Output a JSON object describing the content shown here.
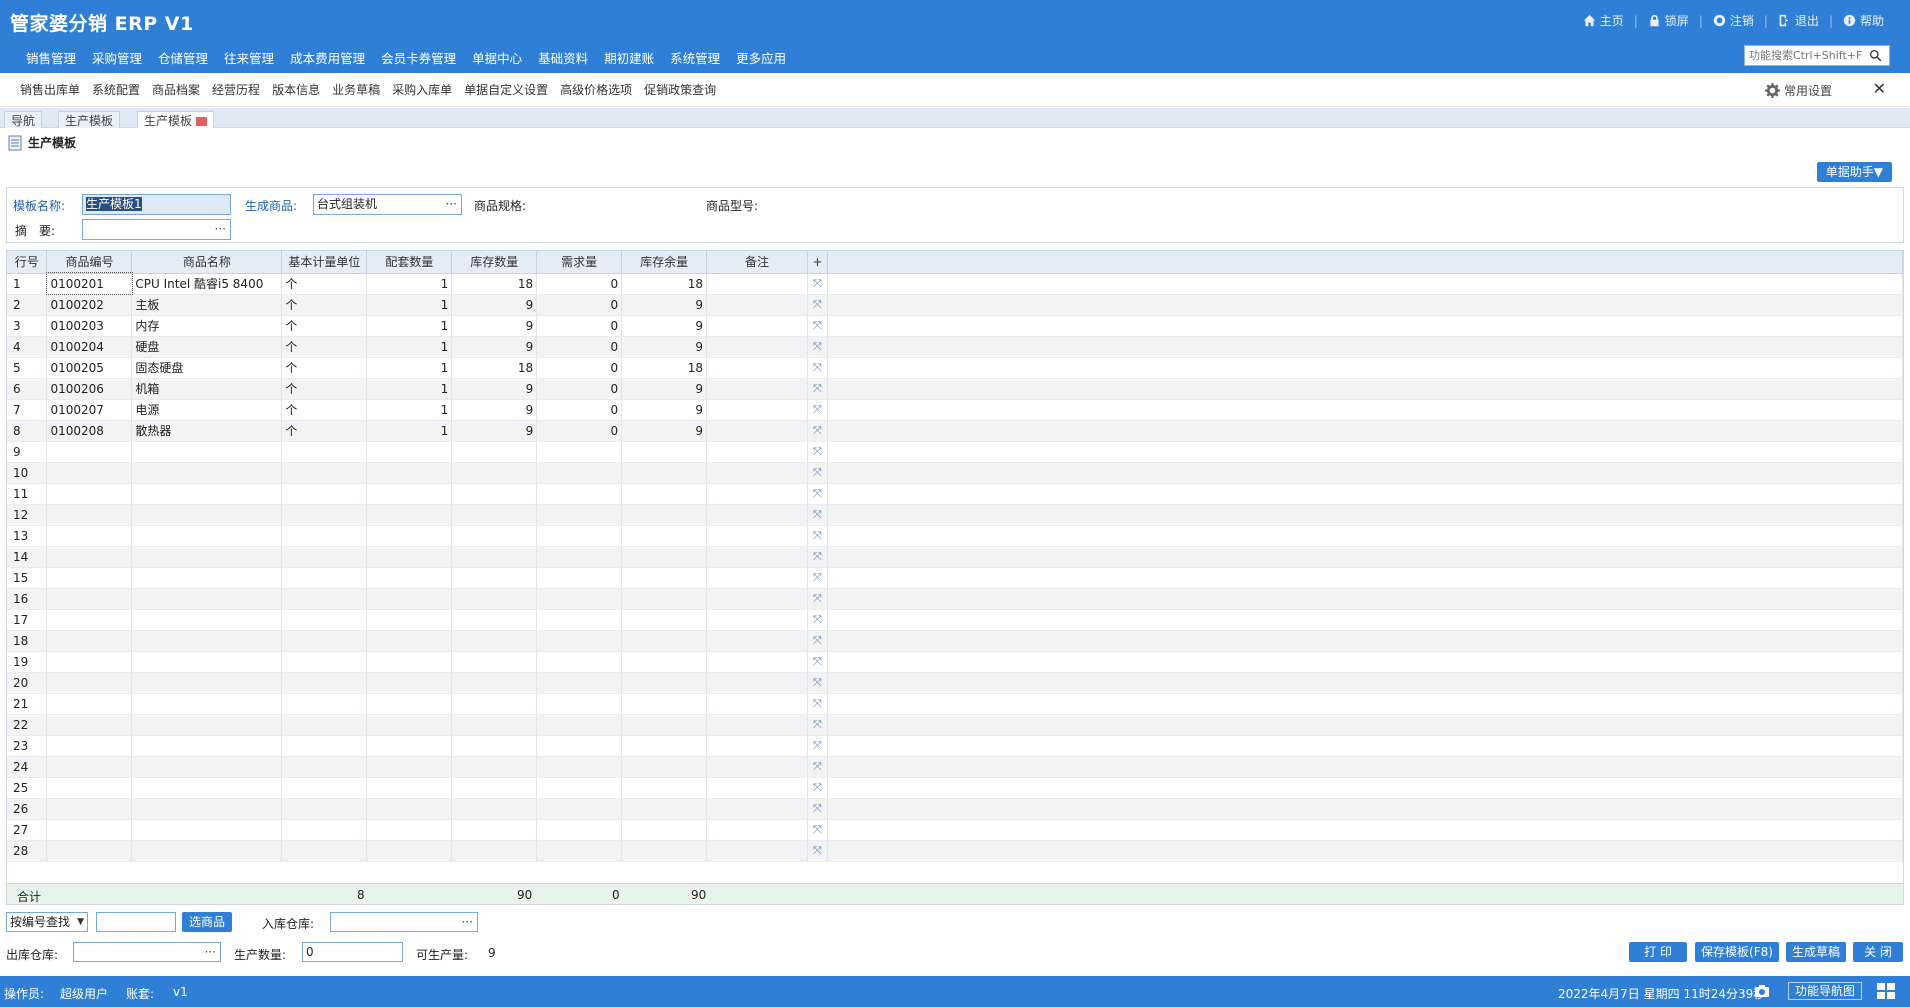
{
  "app": {
    "title": "管家婆分销 ERP V1",
    "top_links": [
      {
        "icon": "home-icon",
        "label": "主页"
      },
      {
        "icon": "lock-icon",
        "label": "锁屏"
      },
      {
        "icon": "logout-circle-icon",
        "label": "注销"
      },
      {
        "icon": "exit-icon",
        "label": "退出"
      },
      {
        "icon": "help-icon",
        "label": "帮助"
      }
    ],
    "main_menu": [
      "销售管理",
      "采购管理",
      "仓储管理",
      "往来管理",
      "成本费用管理",
      "会员卡券管理",
      "单据中心",
      "基础资料",
      "期初建账",
      "系统管理",
      "更多应用"
    ],
    "search_placeholder": "功能搜索Ctrl+Shift+F"
  },
  "sub_menu": [
    "销售出库单",
    "系统配置",
    "商品档案",
    "经营历程",
    "版本信息",
    "业务草稿",
    "采购入库单",
    "单据自定义设置",
    "高级价格选项",
    "促销政策查询"
  ],
  "common_settings": "常用设置",
  "close_symbol": "✕",
  "tabs": [
    "导航",
    "生产模板",
    "生产模板"
  ],
  "page_title": "生产模板",
  "assist_button": "单据助手▼",
  "form": {
    "template_name_label": "模板名称:",
    "template_name_value": "生产模板1",
    "product_label": "生成商品:",
    "product_value": "台式组装机",
    "spec_label": "商品规格:",
    "model_label": "商品型号:",
    "summary_label": "摘　要:",
    "dots": "···"
  },
  "grid": {
    "columns": [
      "行号",
      "商品编号",
      "商品名称",
      "基本计量单位",
      "配套数量",
      "库存数量",
      "需求量",
      "库存余量",
      "备注",
      "+"
    ],
    "rows": [
      {
        "no": "1",
        "code": "0100201",
        "name": "CPU Intel 酷睿i5 8400",
        "unit": "个",
        "qty": "1",
        "stock": "18",
        "demand": "0",
        "remain": "18"
      },
      {
        "no": "2",
        "code": "0100202",
        "name": "主板",
        "unit": "个",
        "qty": "1",
        "stock": "9",
        "demand": "0",
        "remain": "9"
      },
      {
        "no": "3",
        "code": "0100203",
        "name": "内存",
        "unit": "个",
        "qty": "1",
        "stock": "9",
        "demand": "0",
        "remain": "9"
      },
      {
        "no": "4",
        "code": "0100204",
        "name": "硬盘",
        "unit": "个",
        "qty": "1",
        "stock": "9",
        "demand": "0",
        "remain": "9"
      },
      {
        "no": "5",
        "code": "0100205",
        "name": "固态硬盘",
        "unit": "个",
        "qty": "1",
        "stock": "18",
        "demand": "0",
        "remain": "18"
      },
      {
        "no": "6",
        "code": "0100206",
        "name": "机箱",
        "unit": "个",
        "qty": "1",
        "stock": "9",
        "demand": "0",
        "remain": "9"
      },
      {
        "no": "7",
        "code": "0100207",
        "name": "电源",
        "unit": "个",
        "qty": "1",
        "stock": "9",
        "demand": "0",
        "remain": "9"
      },
      {
        "no": "8",
        "code": "0100208",
        "name": "散热器",
        "unit": "个",
        "qty": "1",
        "stock": "9",
        "demand": "0",
        "remain": "9"
      }
    ],
    "empty_row_numbers": [
      "9",
      "10",
      "11",
      "12",
      "13",
      "14",
      "15",
      "16",
      "17",
      "18",
      "19",
      "20",
      "21",
      "22",
      "23",
      "24",
      "25",
      "26",
      "27",
      "28"
    ],
    "delete_symbol": "⤧",
    "total": {
      "label": "合计",
      "qty": "8",
      "stock": "90",
      "demand": "0",
      "remain": "90"
    }
  },
  "bottom": {
    "search_mode": "按编号查找",
    "select_goods_button": "选商品",
    "in_warehouse_label": "入库仓库:",
    "out_warehouse_label": "出库仓库:",
    "produce_qty_label": "生产数量:",
    "produce_qty_value": "0",
    "max_qty_label": "可生产量:",
    "max_qty_value": "9",
    "buttons": [
      "打 印",
      "保存模板(F8)",
      "生成草稿",
      "关 闭"
    ]
  },
  "status": {
    "operator_label": "操作员:",
    "operator_value": "超级用户",
    "account_label": "账套:",
    "account_value": "v1",
    "datetime": "2022年4月7日  星期四  11时24分39秒",
    "nav_map": "功能导航图"
  },
  "colors": {
    "primary": "#2f7fd6",
    "grid_header": "#e4edf6",
    "total_row": "#e9f3ea"
  }
}
